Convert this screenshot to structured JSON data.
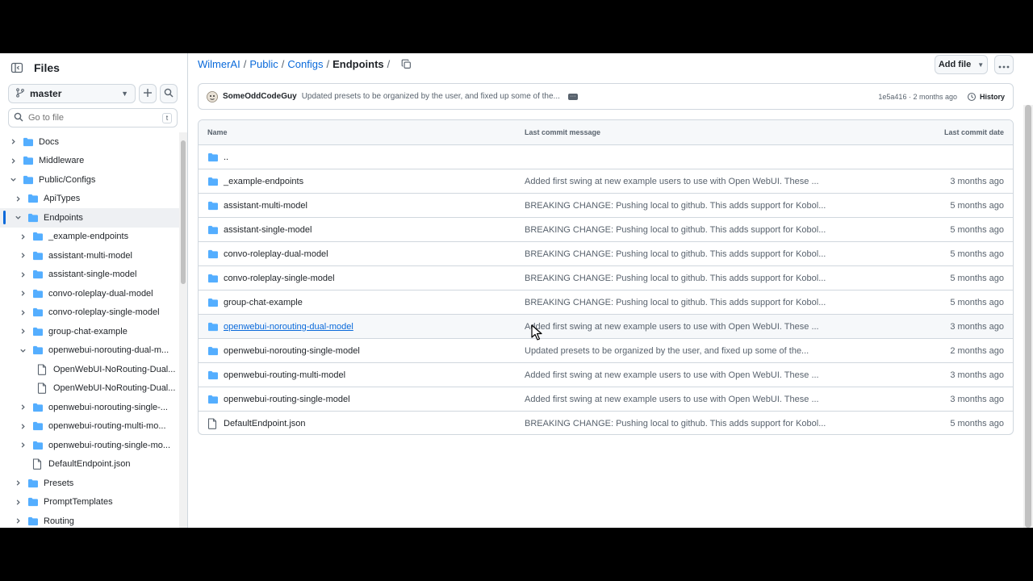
{
  "sidebar": {
    "title": "Files",
    "branch": "master",
    "goto_placeholder": "Go to file",
    "goto_shortcut": "t",
    "tree": [
      {
        "label": "Docs",
        "type": "folder",
        "level": 0,
        "expanded": false
      },
      {
        "label": "Middleware",
        "type": "folder",
        "level": 0,
        "expanded": false
      },
      {
        "label": "Public/Configs",
        "type": "folder",
        "level": 0,
        "expanded": true
      },
      {
        "label": "ApiTypes",
        "type": "folder",
        "level": 1,
        "expanded": false
      },
      {
        "label": "Endpoints",
        "type": "folder",
        "level": 1,
        "expanded": true,
        "active": true
      },
      {
        "label": "_example-endpoints",
        "type": "folder",
        "level": 2,
        "expanded": false
      },
      {
        "label": "assistant-multi-model",
        "type": "folder",
        "level": 2,
        "expanded": false
      },
      {
        "label": "assistant-single-model",
        "type": "folder",
        "level": 2,
        "expanded": false
      },
      {
        "label": "convo-roleplay-dual-model",
        "type": "folder",
        "level": 2,
        "expanded": false
      },
      {
        "label": "convo-roleplay-single-model",
        "type": "folder",
        "level": 2,
        "expanded": false
      },
      {
        "label": "group-chat-example",
        "type": "folder",
        "level": 2,
        "expanded": false
      },
      {
        "label": "openwebui-norouting-dual-m...",
        "type": "folder",
        "level": 2,
        "expanded": true
      },
      {
        "label": "OpenWebUI-NoRouting-Dual...",
        "type": "file",
        "level": 3
      },
      {
        "label": "OpenWebUI-NoRouting-Dual...",
        "type": "file",
        "level": 3
      },
      {
        "label": "openwebui-norouting-single-...",
        "type": "folder",
        "level": 2,
        "expanded": false
      },
      {
        "label": "openwebui-routing-multi-mo...",
        "type": "folder",
        "level": 2,
        "expanded": false
      },
      {
        "label": "openwebui-routing-single-mo...",
        "type": "folder",
        "level": 2,
        "expanded": false
      },
      {
        "label": "DefaultEndpoint.json",
        "type": "file",
        "level": 2
      },
      {
        "label": "Presets",
        "type": "folder",
        "level": 1,
        "expanded": false
      },
      {
        "label": "PromptTemplates",
        "type": "folder",
        "level": 1,
        "expanded": false
      },
      {
        "label": "Routing",
        "type": "folder",
        "level": 1,
        "expanded": false
      }
    ]
  },
  "breadcrumb": {
    "parts": [
      "WilmerAI",
      "Public",
      "Configs"
    ],
    "current": "Endpoints",
    "sep": "/"
  },
  "toolbar": {
    "add_file": "Add file"
  },
  "commit": {
    "author": "SomeOddCodeGuy",
    "message": "Updated presets to be organized by the user, and fixed up some of the...",
    "meta": "1e5a416 · 2 months ago",
    "history": "History"
  },
  "table": {
    "headers": {
      "name": "Name",
      "message": "Last commit message",
      "date": "Last commit date"
    },
    "rows": [
      {
        "name": "..",
        "type": "folder",
        "message": "",
        "date": ""
      },
      {
        "name": "_example-endpoints",
        "type": "folder",
        "message": "Added first swing at new example users to use with Open WebUI. These ...",
        "date": "3 months ago"
      },
      {
        "name": "assistant-multi-model",
        "type": "folder",
        "message": "BREAKING CHANGE: Pushing local to github. This adds support for Kobol...",
        "date": "5 months ago"
      },
      {
        "name": "assistant-single-model",
        "type": "folder",
        "message": "BREAKING CHANGE: Pushing local to github. This adds support for Kobol...",
        "date": "5 months ago"
      },
      {
        "name": "convo-roleplay-dual-model",
        "type": "folder",
        "message": "BREAKING CHANGE: Pushing local to github. This adds support for Kobol...",
        "date": "5 months ago"
      },
      {
        "name": "convo-roleplay-single-model",
        "type": "folder",
        "message": "BREAKING CHANGE: Pushing local to github. This adds support for Kobol...",
        "date": "5 months ago"
      },
      {
        "name": "group-chat-example",
        "type": "folder",
        "message": "BREAKING CHANGE: Pushing local to github. This adds support for Kobol...",
        "date": "5 months ago"
      },
      {
        "name": "openwebui-norouting-dual-model",
        "type": "folder",
        "message": "Added first swing at new example users to use with Open WebUI. These ...",
        "date": "3 months ago",
        "hover": true
      },
      {
        "name": "openwebui-norouting-single-model",
        "type": "folder",
        "message": "Updated presets to be organized by the user, and fixed up some of the...",
        "date": "2 months ago"
      },
      {
        "name": "openwebui-routing-multi-model",
        "type": "folder",
        "message": "Added first swing at new example users to use with Open WebUI. These ...",
        "date": "3 months ago"
      },
      {
        "name": "openwebui-routing-single-model",
        "type": "folder",
        "message": "Added first swing at new example users to use with Open WebUI. These ...",
        "date": "3 months ago"
      },
      {
        "name": "DefaultEndpoint.json",
        "type": "file",
        "message": "BREAKING CHANGE: Pushing local to github. This adds support for Kobol...",
        "date": "5 months ago"
      }
    ]
  },
  "colors": {
    "folder": "#54aeff",
    "link": "#0969da",
    "border": "#d0d7de",
    "muted": "#59636e"
  }
}
